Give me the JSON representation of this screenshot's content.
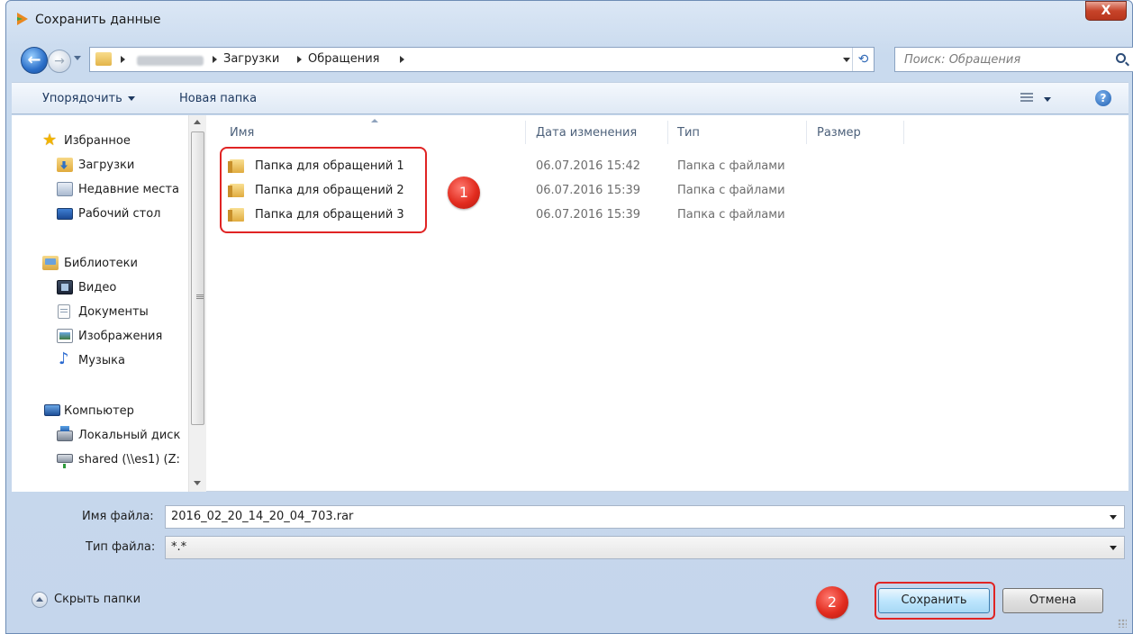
{
  "window": {
    "title": "Сохранить данные",
    "close_glyph": "X"
  },
  "navbar": {
    "back_glyph": "←",
    "forward_glyph": "→",
    "breadcrumbs": [
      "Загрузки",
      "Обращения"
    ],
    "search_placeholder": "Поиск: Обращения",
    "refresh_glyph": "⟲"
  },
  "toolbar": {
    "organize_label": "Упорядочить",
    "new_folder_label": "Новая папка",
    "help_glyph": "?"
  },
  "nav_pane": {
    "favorites": {
      "label": "Избранное",
      "icon": "star-icon",
      "items": [
        {
          "label": "Загрузки",
          "icon": "downloads-icon"
        },
        {
          "label": "Недавние места",
          "icon": "recent-places-icon"
        },
        {
          "label": "Рабочий стол",
          "icon": "desktop-icon"
        }
      ]
    },
    "libraries": {
      "label": "Библиотеки",
      "icon": "library-icon",
      "items": [
        {
          "label": "Видео",
          "icon": "video-icon"
        },
        {
          "label": "Документы",
          "icon": "documents-icon"
        },
        {
          "label": "Изображения",
          "icon": "images-icon"
        },
        {
          "label": "Музыка",
          "icon": "music-icon"
        }
      ]
    },
    "computer": {
      "label": "Компьютер",
      "icon": "computer-icon",
      "items": [
        {
          "label": "Локальный диск",
          "icon": "local-disk-icon"
        },
        {
          "label": "shared (\\\\es1) (Z:",
          "icon": "network-drive-icon"
        }
      ]
    }
  },
  "file_list": {
    "columns": [
      "Имя",
      "Дата изменения",
      "Тип",
      "Размер"
    ],
    "rows": [
      {
        "name": "Папка для обращений 1",
        "date": "06.07.2016 15:42",
        "type": "Папка с файлами",
        "size": ""
      },
      {
        "name": "Папка для обращений 2",
        "date": "06.07.2016 15:39",
        "type": "Папка с файлами",
        "size": ""
      },
      {
        "name": "Папка для обращений 3",
        "date": "06.07.2016 15:39",
        "type": "Папка с файлами",
        "size": ""
      }
    ]
  },
  "form": {
    "filename_label": "Имя файла:",
    "filename_value": "2016_02_20_14_20_04_703.rar",
    "filetype_label": "Тип файла:",
    "filetype_value": "*.*"
  },
  "footer": {
    "hide_folders_label": "Скрыть папки",
    "save_label": "Сохранить",
    "cancel_label": "Отмена"
  },
  "annotations": {
    "marker_1": "1",
    "marker_2": "2",
    "highlight_color": "#e02424"
  }
}
